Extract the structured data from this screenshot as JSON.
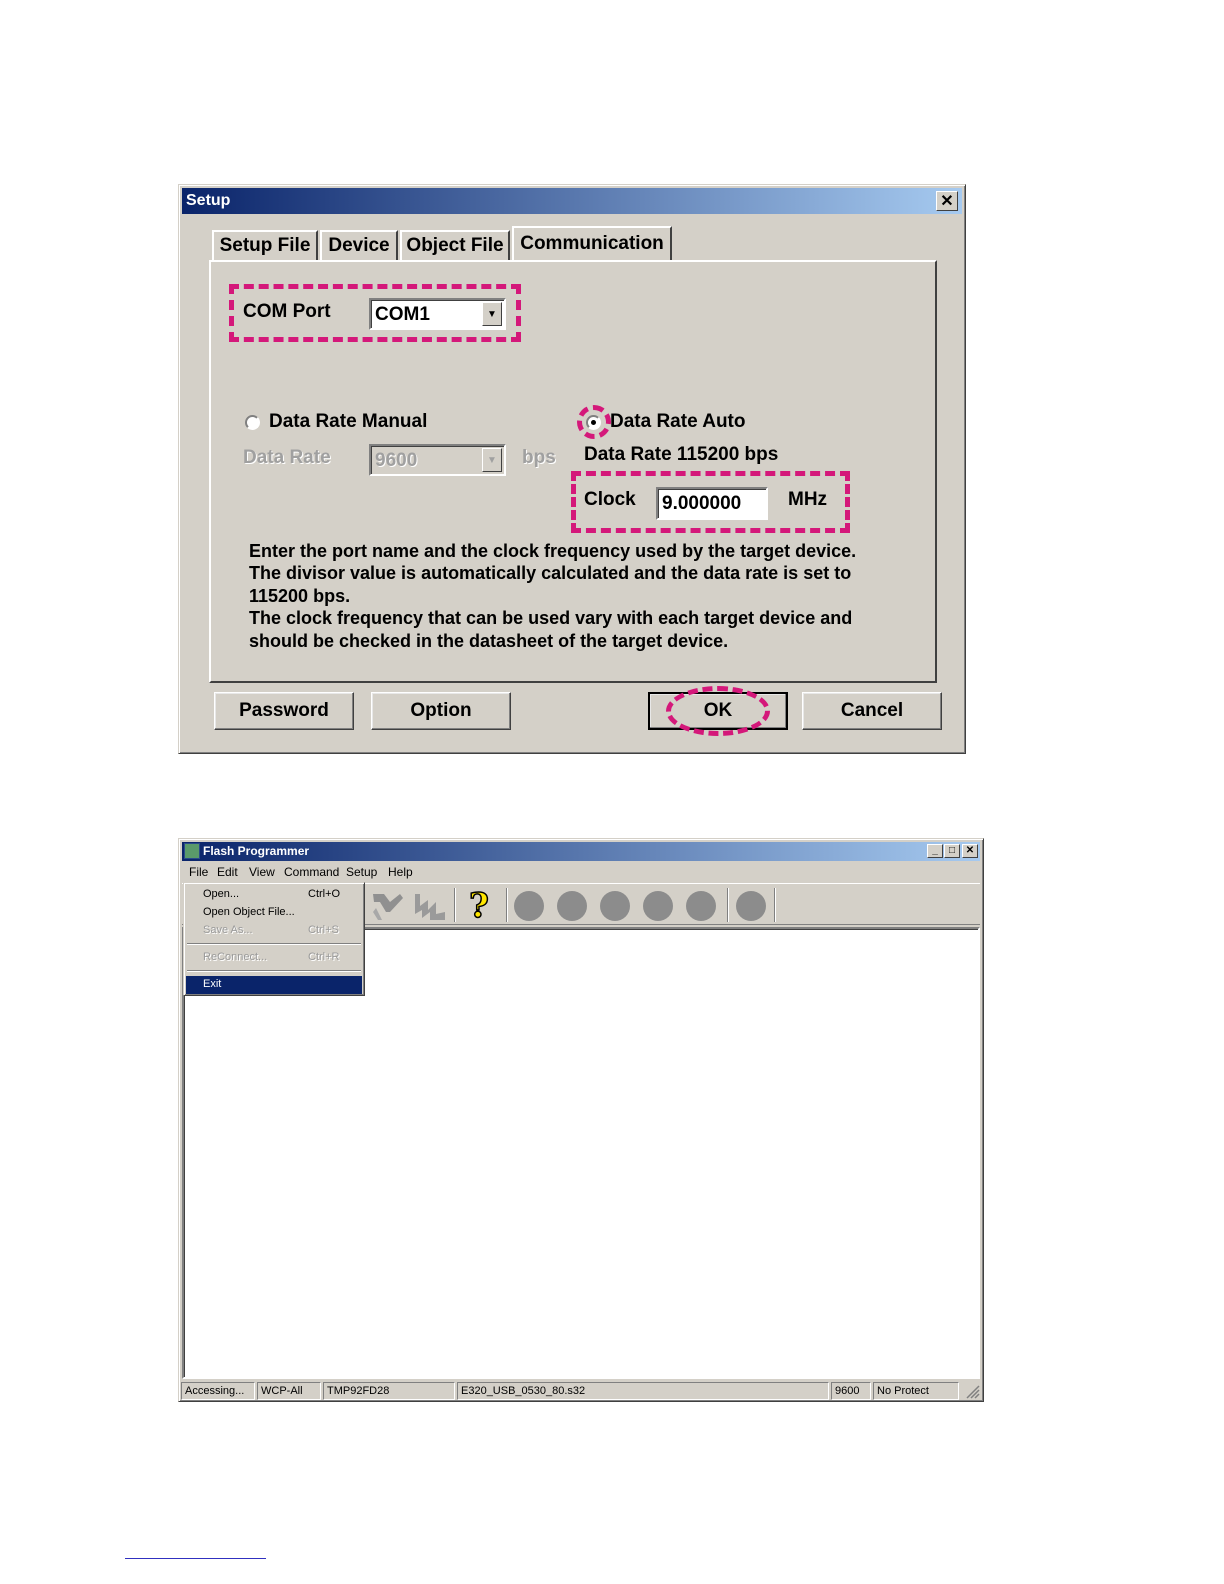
{
  "setup_dialog": {
    "title": "Setup",
    "close_label": "✕",
    "tabs": [
      {
        "label": "Setup File"
      },
      {
        "label": "Device"
      },
      {
        "label": "Object File"
      },
      {
        "label": "Communication",
        "active": true
      }
    ],
    "com_port": {
      "label": "COM Port",
      "value": "COM1"
    },
    "data_rate_manual": {
      "label": "Data Rate Manual",
      "selected": false
    },
    "data_rate_field": {
      "label": "Data Rate",
      "value": "9600",
      "unit": "bps"
    },
    "data_rate_auto": {
      "label": "Data Rate Auto",
      "selected": true
    },
    "auto_rate_text": "Data Rate 115200 bps",
    "clock": {
      "label": "Clock",
      "value": "9.000000",
      "unit": "MHz"
    },
    "info_lines": [
      "Enter the port name and the clock frequency used by the target device.",
      "The divisor value is automatically calculated and the data rate is set to",
      "115200 bps.",
      "The clock frequency that can be used vary with each target device and",
      "should be checked in the datasheet of the target device."
    ],
    "buttons": {
      "password": "Password",
      "option": "Option",
      "ok": "OK",
      "cancel": "Cancel"
    },
    "highlight_color": "#d4187a"
  },
  "flash_programmer": {
    "title": "Flash Programmer",
    "window_buttons": {
      "minimize": "_",
      "maximize": "□",
      "close": "✕"
    },
    "menu": [
      "File",
      "Edit",
      "View",
      "Command",
      "Setup",
      "Help"
    ],
    "file_menu": [
      {
        "label": "Open...",
        "shortcut": "Ctrl+O",
        "enabled": true
      },
      {
        "label": "Open Object File...",
        "shortcut": "",
        "enabled": true
      },
      {
        "label": "Save As...",
        "shortcut": "Ctrl+S",
        "enabled": false
      },
      {
        "label": "ReConnect...",
        "shortcut": "Ctrl+R",
        "enabled": false
      },
      {
        "label": "Exit",
        "shortcut": "",
        "enabled": true,
        "selected": true
      }
    ],
    "toolbar_icons": [
      "connect-icon",
      "disconnect-icon",
      "help-icon",
      "status-led-icon"
    ],
    "help_glyph": "?",
    "status_bar": [
      "Accessing...",
      "WCP-All",
      "TMP92FD28",
      "E320_USB_0530_80.s32",
      "9600",
      "No Protect"
    ]
  }
}
